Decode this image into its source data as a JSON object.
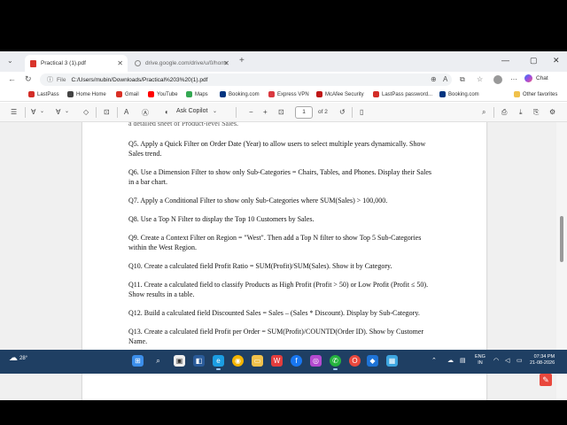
{
  "tabs": [
    {
      "title": "Practical 3 (1).pdf",
      "active": true
    },
    {
      "title": "drive.google.com/drive/u/0/home",
      "active": false
    }
  ],
  "window": {
    "minimize": "—",
    "maximize": "▢",
    "close": "✕"
  },
  "address": {
    "scheme_label": "File",
    "url": "C:/Users/mubin/Downloads/Practical%203%20(1).pdf"
  },
  "copilot": {
    "label": "Chat"
  },
  "bookmarks": [
    {
      "label": "LastPass",
      "color": "#d32d27"
    },
    {
      "label": "Home Home",
      "color": "#444444"
    },
    {
      "label": "Gmail",
      "color": "#d93025"
    },
    {
      "label": "YouTube",
      "color": "#ff0000"
    },
    {
      "label": "Maps",
      "color": "#34a853"
    },
    {
      "label": "Booking.com",
      "color": "#003580"
    },
    {
      "label": "Express VPN",
      "color": "#da3940"
    },
    {
      "label": "McAfee Security",
      "color": "#c01818"
    },
    {
      "label": "LastPass password...",
      "color": "#d32d27"
    },
    {
      "label": "Booking.com",
      "color": "#003580"
    }
  ],
  "other_favorites": "Other favorites",
  "pdf_toolbar": {
    "ask_copilot": "Ask Copilot",
    "page_current": "1",
    "page_total": "of 2"
  },
  "pdf_questions": [
    "a detailed sheet of Product-level Sales.",
    "Q5. Apply a Quick Filter on Order Date (Year) to allow users to select multiple years dynamically. Show Sales trend.",
    "Q6. Use a Dimension Filter to show only Sub-Categories = Chairs, Tables, and Phones. Display their Sales in a bar chart.",
    "Q7. Apply a Conditional Filter to show only Sub-Categories where SUM(Sales) > 100,000.",
    "Q8. Use a Top N Filter to display the Top 10 Customers by Sales.",
    "Q9. Create a Context Filter on Region = \"West\". Then add a Top N filter to show Top 5 Sub-Categories within the West Region.",
    "Q10. Create a calculated field Profit Ratio = SUM(Profit)/SUM(Sales). Show it by Category.",
    "Q11. Create a calculated field to classify Products as High Profit (Profit > 50) or Low Profit (Profit ≤ 50). Show results in a table.",
    "Q12. Build a calculated field Discounted Sales = Sales – (Sales * Discount). Display by Sub-Category.",
    "Q13. Create a calculated field Profit per Order = SUM(Profit)/COUNTD(Order ID). Show by Customer Name."
  ],
  "taskbar": {
    "weather": "28°",
    "lang_line1": "ENG",
    "lang_line2": "IN",
    "time": "07:34 PM",
    "date": "21-08-2026"
  }
}
